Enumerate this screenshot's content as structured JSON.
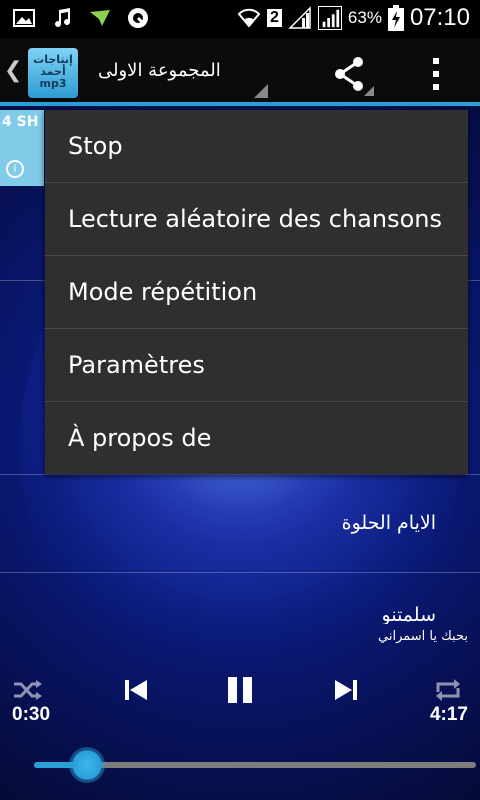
{
  "status_bar": {
    "sim_slot": "2",
    "battery_percent": "63%",
    "time": "07:10",
    "icons": [
      "gallery-icon",
      "music-icon",
      "download-icon",
      "headset-icon",
      "wifi-icon",
      "signal-icon",
      "signal-icon",
      "battery-charging-icon"
    ]
  },
  "action_bar": {
    "title": "المجموعة الاولى",
    "logo_text": "إنتاجات أحمد mp3",
    "back_icon": "chevron-left-icon",
    "share_icon": "share-icon",
    "overflow_icon": "overflow-menu-icon"
  },
  "tab": {
    "label": "4 SH"
  },
  "menu": {
    "items": [
      {
        "label": "Stop"
      },
      {
        "label": "Lecture aléatoire des chansons"
      },
      {
        "label": "Mode répétition"
      },
      {
        "label": "Paramètres"
      },
      {
        "label": "À propos de"
      }
    ]
  },
  "songs": {
    "items": [
      {
        "title": "الايام الحلوة"
      },
      {
        "title": "سلمتنو"
      }
    ]
  },
  "player": {
    "now_playing": "بحبك يا اسمراني",
    "elapsed": "0:30",
    "duration": "4:17",
    "progress_fraction": 0.12,
    "shuffle_icon": "shuffle-icon",
    "previous_icon": "skip-previous-icon",
    "pause_icon": "pause-icon",
    "next_icon": "skip-next-icon",
    "repeat_icon": "repeat-icon"
  },
  "colors": {
    "accent": "#2aa0d9",
    "menu_bg": "#2f2f2f"
  }
}
